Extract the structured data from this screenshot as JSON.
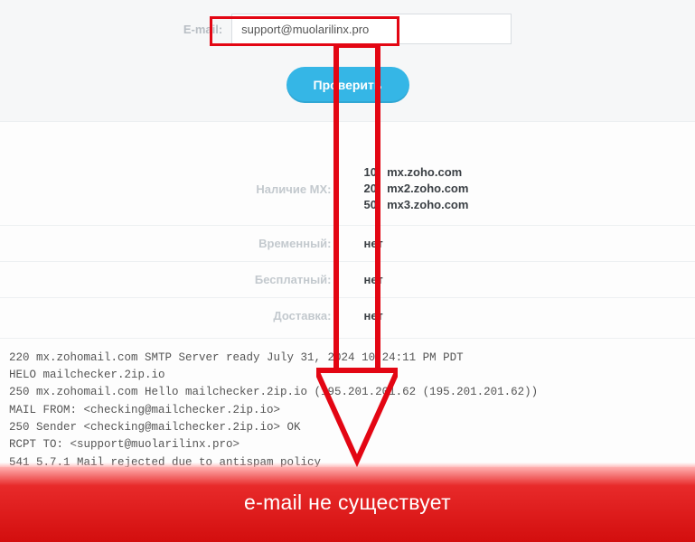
{
  "form": {
    "email_label": "E-mail:",
    "email_value": "support@muolarilinx.pro",
    "check_label": "Проверить"
  },
  "results": {
    "mx_label": "Наличие MX:",
    "mx": [
      {
        "priority": "10",
        "host": "mx.zoho.com"
      },
      {
        "priority": "20",
        "host": "mx2.zoho.com"
      },
      {
        "priority": "50",
        "host": "mx3.zoho.com"
      }
    ],
    "temp_label": "Временный:",
    "temp_value": "нет",
    "free_label": "Бесплатный:",
    "free_value": "нет",
    "deliver_label": "Доставка:",
    "deliver_value": "нет"
  },
  "smtp_log": "220 mx.zohomail.com SMTP Server ready July 31, 2024 10:24:11 PM PDT\nHELO mailchecker.2ip.io\n250 mx.zohomail.com Hello mailchecker.2ip.io (195.201.201.62 (195.201.201.62))\nMAIL FROM: <checking@mailchecker.2ip.io>\n250 Sender <checking@mailchecker.2ip.io> OK\nRCPT TO: <support@muolarilinx.pro>\n541 5.7.1 Mail rejected due to antispam policy",
  "banner": {
    "text": "e-mail не существует"
  }
}
